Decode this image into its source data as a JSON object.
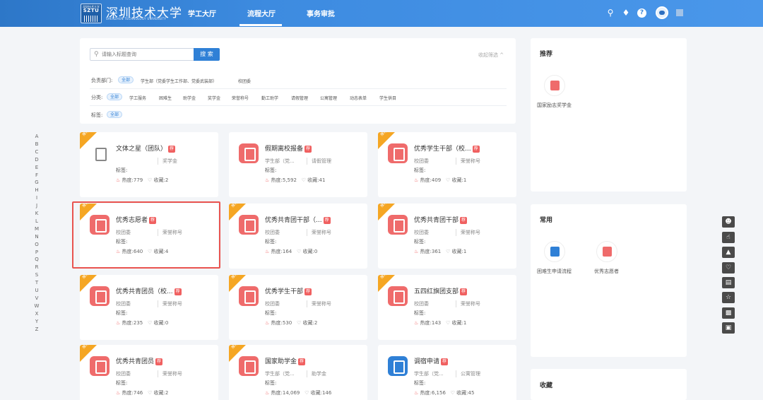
{
  "header": {
    "logo_text": "SZTU",
    "logo_top": "深圳技术大学",
    "university_name": "深圳技术大学",
    "university_sub": "SHENZHEN TECHNOLOGY UNIVERSITY",
    "nav": [
      "学工大厅",
      "流程大厅",
      "事务审批"
    ]
  },
  "search": {
    "placeholder": "请输入标题查询",
    "button": "搜 索",
    "collapse": "收起筛选 ^"
  },
  "filters": {
    "dept_label": "负责部门:",
    "dept_options": [
      "全部",
      "学生部（党委学生工作部、党委武装部）",
      "校团委"
    ],
    "cat_label": "分类:",
    "cat_options": [
      "全部",
      "学工服务",
      "困难生",
      "助学金",
      "奖学金",
      "荣誉称号",
      "勤工助学",
      "请假管理",
      "公寓管理",
      "动态表单",
      "学生供目"
    ],
    "tag_label": "标签:",
    "tag_options": [
      "全部"
    ]
  },
  "alphabet": [
    "A",
    "B",
    "C",
    "D",
    "E",
    "F",
    "G",
    "H",
    "I",
    "J",
    "K",
    "L",
    "M",
    "N",
    "O",
    "P",
    "Q",
    "R",
    "S",
    "T",
    "U",
    "V",
    "W",
    "X",
    "Y",
    "Z"
  ],
  "card_common": {
    "tag_label": "标签:",
    "heat_label": "热度:",
    "fav_label": "收藏:",
    "ribbon": "推荐",
    "badge": "荐"
  },
  "cards": [
    {
      "title": "文体之星（团队）",
      "dept": "",
      "cat": "奖学金",
      "heat": "779",
      "fav": "2",
      "ribbon": true,
      "icon": "image-placeholder-icon"
    },
    {
      "title": "假期离校报备",
      "dept": "学生部（党...",
      "cat": "请假管理",
      "heat": "5,592",
      "fav": "41",
      "ribbon": false,
      "icon": "leave-report-icon"
    },
    {
      "title": "优秀学生干部（校...",
      "dept": "校团委",
      "cat": "荣誉称号",
      "heat": "409",
      "fav": "1",
      "ribbon": true,
      "icon": "trophy-icon"
    },
    {
      "title": "优秀志愿者",
      "dept": "校团委",
      "cat": "荣誉称号",
      "heat": "640",
      "fav": "4",
      "ribbon": true,
      "icon": "volunteer-icon"
    },
    {
      "title": "优秀共青团干部（...",
      "dept": "校团委",
      "cat": "荣誉称号",
      "heat": "164",
      "fav": "0",
      "ribbon": true,
      "icon": "cadre-icon"
    },
    {
      "title": "优秀共青团干部",
      "dept": "校团委",
      "cat": "荣誉称号",
      "heat": "361",
      "fav": "1",
      "ribbon": true,
      "icon": "cadre-icon"
    },
    {
      "title": "优秀共青团员（校...",
      "dept": "校团委",
      "cat": "荣誉称号",
      "heat": "235",
      "fav": "0",
      "ribbon": true,
      "icon": "member-icon"
    },
    {
      "title": "优秀学生干部",
      "dept": "校团委",
      "cat": "荣誉称号",
      "heat": "530",
      "fav": "2",
      "ribbon": true,
      "icon": "trophy-icon"
    },
    {
      "title": "五四红旗团支部",
      "dept": "校团委",
      "cat": "荣誉称号",
      "heat": "143",
      "fav": "1",
      "ribbon": true,
      "icon": "flag-icon"
    },
    {
      "title": "优秀共青团员",
      "dept": "校团委",
      "cat": "荣誉称号",
      "heat": "746",
      "fav": "2",
      "ribbon": true,
      "icon": "member-icon"
    },
    {
      "title": "国家助学金",
      "dept": "学生部（党...",
      "cat": "助学金",
      "heat": "14,069",
      "fav": "146",
      "ribbon": true,
      "icon": "grant-icon"
    },
    {
      "title": "调宿申请",
      "dept": "学生部（党...",
      "cat": "公寓管理",
      "heat": "6,156",
      "fav": "45",
      "ribbon": false,
      "icon": "dorm-icon"
    }
  ],
  "sidebar": {
    "recommend_title": "推荐",
    "recommend_items": [
      {
        "label": "国家励志奖学金"
      }
    ],
    "common_title": "常用",
    "common_items": [
      {
        "label": "困难生申请流程"
      },
      {
        "label": "优秀志愿者"
      }
    ],
    "fav_title": "收藏"
  },
  "colors": {
    "header": "#3a86d8",
    "accent": "#2f80d6",
    "icon_red": "#ef6b6b",
    "ribbon": "#f5a623",
    "highlight": "#e9534f"
  }
}
